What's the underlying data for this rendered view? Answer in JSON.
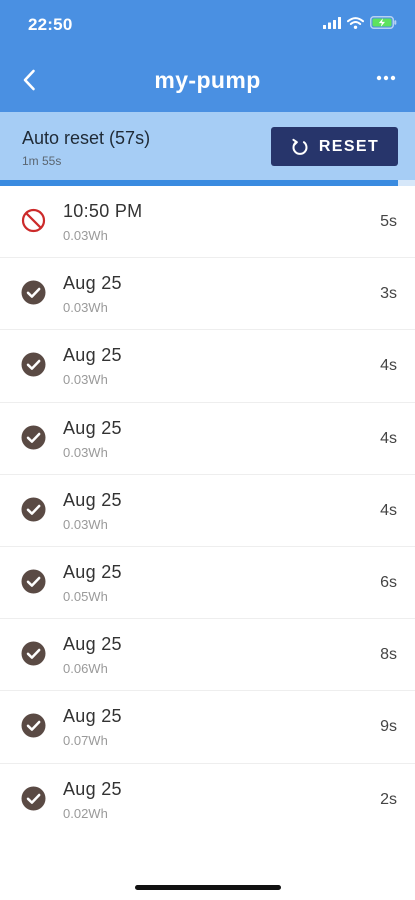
{
  "status_bar": {
    "time": "22:50"
  },
  "nav": {
    "title": "my-pump"
  },
  "auto_reset": {
    "title": "Auto reset (57s)",
    "elapsed": "1m 55s",
    "button_label": "RESET",
    "progress_fraction": 0.96
  },
  "colors": {
    "header": "#4a90e2",
    "reset_bar": "#a6cdf5",
    "reset_button": "#27356b",
    "progress": "#3a8be0",
    "check": "#5a4a44",
    "blocked": "#cc2a2a"
  },
  "events": [
    {
      "status_icon": "blocked-icon",
      "title": "10:50 PM",
      "energy": "0.03Wh",
      "duration": "5s"
    },
    {
      "status_icon": "check-circle-icon",
      "title": "Aug 25",
      "energy": "0.03Wh",
      "duration": "3s"
    },
    {
      "status_icon": "check-circle-icon",
      "title": "Aug 25",
      "energy": "0.03Wh",
      "duration": "4s"
    },
    {
      "status_icon": "check-circle-icon",
      "title": "Aug 25",
      "energy": "0.03Wh",
      "duration": "4s"
    },
    {
      "status_icon": "check-circle-icon",
      "title": "Aug 25",
      "energy": "0.03Wh",
      "duration": "4s"
    },
    {
      "status_icon": "check-circle-icon",
      "title": "Aug 25",
      "energy": "0.05Wh",
      "duration": "6s"
    },
    {
      "status_icon": "check-circle-icon",
      "title": "Aug 25",
      "energy": "0.06Wh",
      "duration": "8s"
    },
    {
      "status_icon": "check-circle-icon",
      "title": "Aug 25",
      "energy": "0.07Wh",
      "duration": "9s"
    },
    {
      "status_icon": "check-circle-icon",
      "title": "Aug 25",
      "energy": "0.02Wh",
      "duration": "2s"
    }
  ]
}
